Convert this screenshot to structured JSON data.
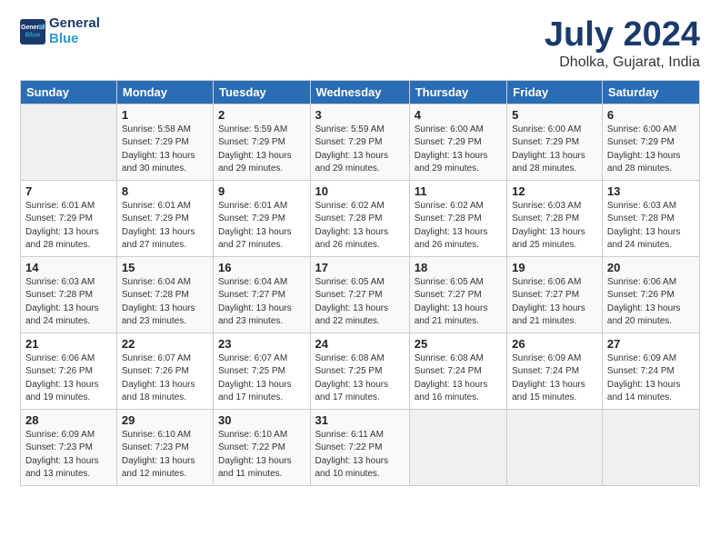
{
  "header": {
    "logo_line1": "General",
    "logo_line2": "Blue",
    "title": "July 2024",
    "subtitle": "Dholka, Gujarat, India"
  },
  "weekdays": [
    "Sunday",
    "Monday",
    "Tuesday",
    "Wednesday",
    "Thursday",
    "Friday",
    "Saturday"
  ],
  "weeks": [
    [
      {
        "day": "",
        "sunrise": "",
        "sunset": "",
        "daylight": ""
      },
      {
        "day": "1",
        "sunrise": "5:58 AM",
        "sunset": "7:29 PM",
        "daylight": "13 hours and 30 minutes."
      },
      {
        "day": "2",
        "sunrise": "5:59 AM",
        "sunset": "7:29 PM",
        "daylight": "13 hours and 29 minutes."
      },
      {
        "day": "3",
        "sunrise": "5:59 AM",
        "sunset": "7:29 PM",
        "daylight": "13 hours and 29 minutes."
      },
      {
        "day": "4",
        "sunrise": "6:00 AM",
        "sunset": "7:29 PM",
        "daylight": "13 hours and 29 minutes."
      },
      {
        "day": "5",
        "sunrise": "6:00 AM",
        "sunset": "7:29 PM",
        "daylight": "13 hours and 28 minutes."
      },
      {
        "day": "6",
        "sunrise": "6:00 AM",
        "sunset": "7:29 PM",
        "daylight": "13 hours and 28 minutes."
      }
    ],
    [
      {
        "day": "7",
        "sunrise": "6:01 AM",
        "sunset": "7:29 PM",
        "daylight": "13 hours and 28 minutes."
      },
      {
        "day": "8",
        "sunrise": "6:01 AM",
        "sunset": "7:29 PM",
        "daylight": "13 hours and 27 minutes."
      },
      {
        "day": "9",
        "sunrise": "6:01 AM",
        "sunset": "7:29 PM",
        "daylight": "13 hours and 27 minutes."
      },
      {
        "day": "10",
        "sunrise": "6:02 AM",
        "sunset": "7:28 PM",
        "daylight": "13 hours and 26 minutes."
      },
      {
        "day": "11",
        "sunrise": "6:02 AM",
        "sunset": "7:28 PM",
        "daylight": "13 hours and 26 minutes."
      },
      {
        "day": "12",
        "sunrise": "6:03 AM",
        "sunset": "7:28 PM",
        "daylight": "13 hours and 25 minutes."
      },
      {
        "day": "13",
        "sunrise": "6:03 AM",
        "sunset": "7:28 PM",
        "daylight": "13 hours and 24 minutes."
      }
    ],
    [
      {
        "day": "14",
        "sunrise": "6:03 AM",
        "sunset": "7:28 PM",
        "daylight": "13 hours and 24 minutes."
      },
      {
        "day": "15",
        "sunrise": "6:04 AM",
        "sunset": "7:28 PM",
        "daylight": "13 hours and 23 minutes."
      },
      {
        "day": "16",
        "sunrise": "6:04 AM",
        "sunset": "7:27 PM",
        "daylight": "13 hours and 23 minutes."
      },
      {
        "day": "17",
        "sunrise": "6:05 AM",
        "sunset": "7:27 PM",
        "daylight": "13 hours and 22 minutes."
      },
      {
        "day": "18",
        "sunrise": "6:05 AM",
        "sunset": "7:27 PM",
        "daylight": "13 hours and 21 minutes."
      },
      {
        "day": "19",
        "sunrise": "6:06 AM",
        "sunset": "7:27 PM",
        "daylight": "13 hours and 21 minutes."
      },
      {
        "day": "20",
        "sunrise": "6:06 AM",
        "sunset": "7:26 PM",
        "daylight": "13 hours and 20 minutes."
      }
    ],
    [
      {
        "day": "21",
        "sunrise": "6:06 AM",
        "sunset": "7:26 PM",
        "daylight": "13 hours and 19 minutes."
      },
      {
        "day": "22",
        "sunrise": "6:07 AM",
        "sunset": "7:26 PM",
        "daylight": "13 hours and 18 minutes."
      },
      {
        "day": "23",
        "sunrise": "6:07 AM",
        "sunset": "7:25 PM",
        "daylight": "13 hours and 17 minutes."
      },
      {
        "day": "24",
        "sunrise": "6:08 AM",
        "sunset": "7:25 PM",
        "daylight": "13 hours and 17 minutes."
      },
      {
        "day": "25",
        "sunrise": "6:08 AM",
        "sunset": "7:24 PM",
        "daylight": "13 hours and 16 minutes."
      },
      {
        "day": "26",
        "sunrise": "6:09 AM",
        "sunset": "7:24 PM",
        "daylight": "13 hours and 15 minutes."
      },
      {
        "day": "27",
        "sunrise": "6:09 AM",
        "sunset": "7:24 PM",
        "daylight": "13 hours and 14 minutes."
      }
    ],
    [
      {
        "day": "28",
        "sunrise": "6:09 AM",
        "sunset": "7:23 PM",
        "daylight": "13 hours and 13 minutes."
      },
      {
        "day": "29",
        "sunrise": "6:10 AM",
        "sunset": "7:23 PM",
        "daylight": "13 hours and 12 minutes."
      },
      {
        "day": "30",
        "sunrise": "6:10 AM",
        "sunset": "7:22 PM",
        "daylight": "13 hours and 11 minutes."
      },
      {
        "day": "31",
        "sunrise": "6:11 AM",
        "sunset": "7:22 PM",
        "daylight": "13 hours and 10 minutes."
      },
      {
        "day": "",
        "sunrise": "",
        "sunset": "",
        "daylight": ""
      },
      {
        "day": "",
        "sunrise": "",
        "sunset": "",
        "daylight": ""
      },
      {
        "day": "",
        "sunrise": "",
        "sunset": "",
        "daylight": ""
      }
    ]
  ]
}
